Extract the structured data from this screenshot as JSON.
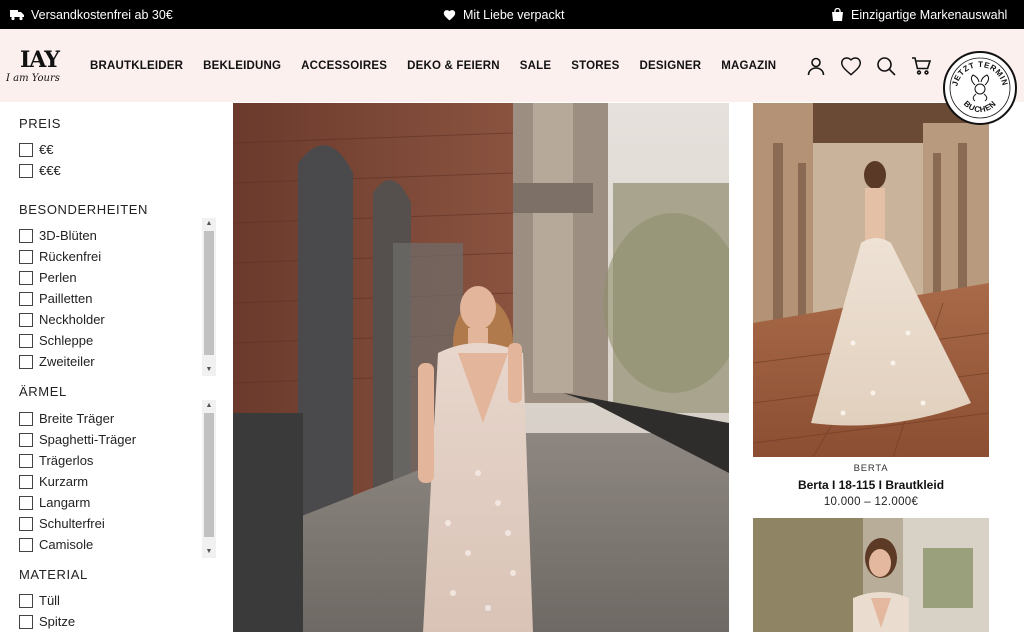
{
  "promo": {
    "shipping": "Versandkostenfrei ab 30€",
    "packaging": "Mit Liebe verpackt",
    "brands": "Einzigartige Markenauswahl"
  },
  "header": {
    "logo_mark": "IAY",
    "logo_script": "I am Yours",
    "nav": [
      "BRAUTKLEIDER",
      "BEKLEIDUNG",
      "ACCESSOIRES",
      "DEKO & FEIERN",
      "SALE",
      "STORES",
      "DESIGNER",
      "MAGAZIN"
    ],
    "icons": [
      "user-icon",
      "heart-icon",
      "search-icon",
      "cart-icon"
    ],
    "badge_top": "JETZT TERMIN",
    "badge_bottom": "BUCHEN"
  },
  "filters": {
    "price": {
      "title": "PREIS",
      "options": [
        "€€",
        "€€€"
      ]
    },
    "features": {
      "title": "BESONDERHEITEN",
      "options": [
        "3D-Blüten",
        "Rückenfrei",
        "Perlen",
        "Pailletten",
        "Neckholder",
        "Schleppe",
        "Zweiteiler"
      ]
    },
    "sleeves": {
      "title": "ÄRMEL",
      "options": [
        "Breite Träger",
        "Spaghetti-Träger",
        "Trägerlos",
        "Kurzarm",
        "Langarm",
        "Schulterfrei",
        "Camisole"
      ]
    },
    "material": {
      "title": "MATERIAL",
      "options": [
        "Tüll",
        "Spitze"
      ]
    }
  },
  "product": {
    "brand": "BERTA",
    "name": "Berta I 18-115 I Brautkleid",
    "price": "10.000 – 12.000€"
  },
  "colors": {
    "promo_bg": "#000000",
    "header_bg": "#fbf0ee"
  }
}
